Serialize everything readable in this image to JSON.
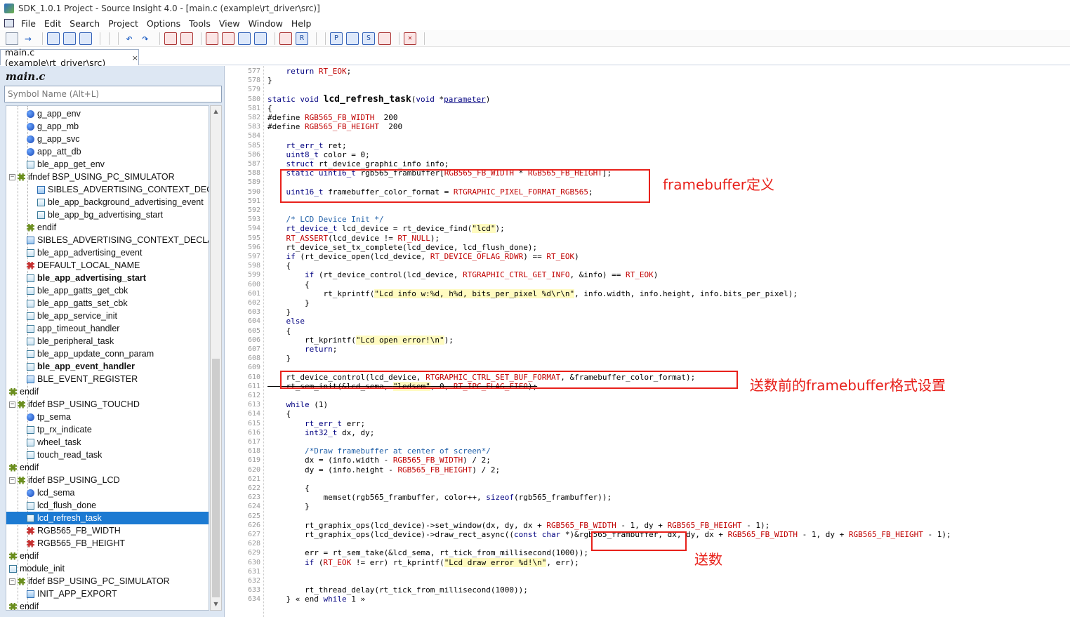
{
  "window": {
    "title": "SDK_1.0.1 Project - Source Insight 4.0 - [main.c (example\\rt_driver\\src)]"
  },
  "menu": [
    "File",
    "Edit",
    "Search",
    "Project",
    "Options",
    "Tools",
    "View",
    "Window",
    "Help"
  ],
  "tab": {
    "label": "main.c (example\\rt_driver\\src)",
    "close": "×"
  },
  "sidebar": {
    "title": "main.c",
    "search_placeholder": "Symbol Name (Alt+L)",
    "items": [
      {
        "label": "g_app_env",
        "icon": "variable-icon",
        "indent": 2
      },
      {
        "label": "g_app_mb",
        "icon": "variable-icon",
        "indent": 2
      },
      {
        "label": "g_app_svc",
        "icon": "variable-icon",
        "indent": 2
      },
      {
        "label": "app_att_db",
        "icon": "variable-icon",
        "indent": 2
      },
      {
        "label": "ble_app_get_env",
        "icon": "function-icon",
        "indent": 2
      },
      {
        "label": "ifndef BSP_USING_PC_SIMULATOR",
        "icon": "preprocessor-icon",
        "indent": 1,
        "expander": "−"
      },
      {
        "label": "SIBLES_ADVERTISING_CONTEXT_DECLA",
        "icon": "struct-icon",
        "indent": 3
      },
      {
        "label": "ble_app_background_advertising_event",
        "icon": "function-icon",
        "indent": 3
      },
      {
        "label": "ble_app_bg_advertising_start",
        "icon": "function-icon",
        "indent": 3
      },
      {
        "label": "endif",
        "icon": "preprocessor-icon",
        "indent": 2
      },
      {
        "label": "SIBLES_ADVERTISING_CONTEXT_DECLAR",
        "icon": "struct-icon",
        "indent": 2
      },
      {
        "label": "ble_app_advertising_event",
        "icon": "function-icon",
        "indent": 2
      },
      {
        "label": "DEFAULT_LOCAL_NAME",
        "icon": "macro-icon",
        "indent": 2
      },
      {
        "label": "ble_app_advertising_start",
        "icon": "function-icon",
        "indent": 2,
        "bold": true
      },
      {
        "label": "ble_app_gatts_get_cbk",
        "icon": "function-icon",
        "indent": 2
      },
      {
        "label": "ble_app_gatts_set_cbk",
        "icon": "function-icon",
        "indent": 2
      },
      {
        "label": "ble_app_service_init",
        "icon": "function-icon",
        "indent": 2
      },
      {
        "label": "app_timeout_handler",
        "icon": "function-icon",
        "indent": 2
      },
      {
        "label": "ble_peripheral_task",
        "icon": "function-icon",
        "indent": 2
      },
      {
        "label": "ble_app_update_conn_param",
        "icon": "function-icon",
        "indent": 2
      },
      {
        "label": "ble_app_event_handler",
        "icon": "function-icon",
        "indent": 2,
        "bold": true
      },
      {
        "label": "BLE_EVENT_REGISTER",
        "icon": "struct-icon",
        "indent": 2
      },
      {
        "label": "endif",
        "icon": "preprocessor-icon",
        "indent": 1
      },
      {
        "label": "ifdef BSP_USING_TOUCHD",
        "icon": "preprocessor-icon",
        "indent": 1,
        "expander": "−"
      },
      {
        "label": "tp_sema",
        "icon": "variable-icon",
        "indent": 2
      },
      {
        "label": "tp_rx_indicate",
        "icon": "function-icon",
        "indent": 2
      },
      {
        "label": "wheel_task",
        "icon": "function-icon",
        "indent": 2
      },
      {
        "label": "touch_read_task",
        "icon": "function-icon",
        "indent": 2
      },
      {
        "label": "endif",
        "icon": "preprocessor-icon",
        "indent": 1
      },
      {
        "label": "ifdef BSP_USING_LCD",
        "icon": "preprocessor-icon",
        "indent": 1,
        "expander": "−"
      },
      {
        "label": "lcd_sema",
        "icon": "variable-icon",
        "indent": 2
      },
      {
        "label": "lcd_flush_done",
        "icon": "function-icon",
        "indent": 2
      },
      {
        "label": "lcd_refresh_task",
        "icon": "function-icon",
        "indent": 2,
        "selected": true
      },
      {
        "label": "RGB565_FB_WIDTH",
        "icon": "macro-icon",
        "indent": 2
      },
      {
        "label": "RGB565_FB_HEIGHT",
        "icon": "macro-icon",
        "indent": 2
      },
      {
        "label": "endif",
        "icon": "preprocessor-icon",
        "indent": 1
      },
      {
        "label": "module_init",
        "icon": "function-icon",
        "indent": 1
      },
      {
        "label": "ifdef BSP_USING_PC_SIMULATOR",
        "icon": "preprocessor-icon",
        "indent": 1,
        "expander": "−"
      },
      {
        "label": "INIT_APP_EXPORT",
        "icon": "struct-icon",
        "indent": 2
      },
      {
        "label": "endif",
        "icon": "preprocessor-icon",
        "indent": 1
      }
    ]
  },
  "code": [
    {
      "n": "577",
      "t": "    return RT_EOK;"
    },
    {
      "n": "578",
      "t": "}"
    },
    {
      "n": "579",
      "t": ""
    },
    {
      "n": "580",
      "t": "static void lcd_refresh_task(void *parameter)"
    },
    {
      "n": "581",
      "t": "{"
    },
    {
      "n": "582",
      "t": "#define RGB565_FB_WIDTH  200"
    },
    {
      "n": "583",
      "t": "#define RGB565_FB_HEIGHT  200"
    },
    {
      "n": "584",
      "t": ""
    },
    {
      "n": "585",
      "t": "    rt_err_t ret;"
    },
    {
      "n": "586",
      "t": "    uint8_t color = 0;"
    },
    {
      "n": "587",
      "t": "    struct rt_device_graphic_info info;"
    },
    {
      "n": "588",
      "t": "    static uint16_t rgb565_frambuffer[RGB565_FB_WIDTH * RGB565_FB_HEIGHT];"
    },
    {
      "n": "589",
      "t": ""
    },
    {
      "n": "590",
      "t": "    uint16_t framebuffer_color_format = RTGRAPHIC_PIXEL_FORMAT_RGB565;"
    },
    {
      "n": "591",
      "t": ""
    },
    {
      "n": "592",
      "t": ""
    },
    {
      "n": "593",
      "t": "    /* LCD Device Init */"
    },
    {
      "n": "594",
      "t": "    rt_device_t lcd_device = rt_device_find(\"lcd\");"
    },
    {
      "n": "595",
      "t": "    RT_ASSERT(lcd_device != RT_NULL);"
    },
    {
      "n": "596",
      "t": "    rt_device_set_tx_complete(lcd_device, lcd_flush_done);"
    },
    {
      "n": "597",
      "t": "    if (rt_device_open(lcd_device, RT_DEVICE_OFLAG_RDWR) == RT_EOK)"
    },
    {
      "n": "598",
      "t": "    {"
    },
    {
      "n": "599",
      "t": "        if (rt_device_control(lcd_device, RTGRAPHIC_CTRL_GET_INFO, &info) == RT_EOK)"
    },
    {
      "n": "600",
      "t": "        {"
    },
    {
      "n": "601",
      "t": "            rt_kprintf(\"Lcd info w:%d, h%d, bits_per_pixel %d\\r\\n\", info.width, info.height, info.bits_per_pixel);"
    },
    {
      "n": "602",
      "t": "        }"
    },
    {
      "n": "603",
      "t": "    }"
    },
    {
      "n": "604",
      "t": "    else"
    },
    {
      "n": "605",
      "t": "    {"
    },
    {
      "n": "606",
      "t": "        rt_kprintf(\"Lcd open error!\\n\");"
    },
    {
      "n": "607",
      "t": "        return;"
    },
    {
      "n": "608",
      "t": "    }"
    },
    {
      "n": "609",
      "t": ""
    },
    {
      "n": "610",
      "t": "    rt_device_control(lcd_device, RTGRAPHIC_CTRL_SET_BUF_FORMAT, &framebuffer_color_format);"
    },
    {
      "n": "611",
      "t": "    rt_sem_init(&lcd_sema, \"ledsem\", 0, RT_IPC_FLAG_FIFO);"
    },
    {
      "n": "612",
      "t": ""
    },
    {
      "n": "613",
      "t": "    while (1)"
    },
    {
      "n": "614",
      "t": "    {"
    },
    {
      "n": "615",
      "t": "        rt_err_t err;"
    },
    {
      "n": "616",
      "t": "        int32_t dx, dy;"
    },
    {
      "n": "617",
      "t": ""
    },
    {
      "n": "618",
      "t": "        /*Draw framebuffer at center of screen*/"
    },
    {
      "n": "619",
      "t": "        dx = (info.width - RGB565_FB_WIDTH) / 2;"
    },
    {
      "n": "620",
      "t": "        dy = (info.height - RGB565_FB_HEIGHT) / 2;"
    },
    {
      "n": "621",
      "t": ""
    },
    {
      "n": "622",
      "t": "        {"
    },
    {
      "n": "623",
      "t": "            memset(rgb565_frambuffer, color++, sizeof(rgb565_frambuffer));"
    },
    {
      "n": "624",
      "t": "        }"
    },
    {
      "n": "625",
      "t": ""
    },
    {
      "n": "626",
      "t": "        rt_graphix_ops(lcd_device)->set_window(dx, dy, dx + RGB565_FB_WIDTH - 1, dy + RGB565_FB_HEIGHT - 1);"
    },
    {
      "n": "627",
      "t": "        rt_graphix_ops(lcd_device)->draw_rect_async((const char *)&rgb565_frambuffer, dx, dy, dx + RGB565_FB_WIDTH - 1, dy + RGB565_FB_HEIGHT - 1);"
    },
    {
      "n": "628",
      "t": ""
    },
    {
      "n": "629",
      "t": "        err = rt_sem_take(&lcd_sema, rt_tick_from_millisecond(1000));"
    },
    {
      "n": "630",
      "t": "        if (RT_EOK != err) rt_kprintf(\"Lcd draw error %d!\\n\", err);"
    },
    {
      "n": "631",
      "t": ""
    },
    {
      "n": "632",
      "t": ""
    },
    {
      "n": "633",
      "t": "        rt_thread_delay(rt_tick_from_millisecond(1000));"
    },
    {
      "n": "634",
      "t": "    } « end while 1 »"
    }
  ],
  "annotations": {
    "a1": "framebuffer定义",
    "a2": "送数前的framebuffer格式设置",
    "a3": "送数"
  },
  "colors": {
    "annotation": "#e8211b",
    "selection": "#1c7ad2",
    "sidebar_bg": "#dde7f3"
  }
}
